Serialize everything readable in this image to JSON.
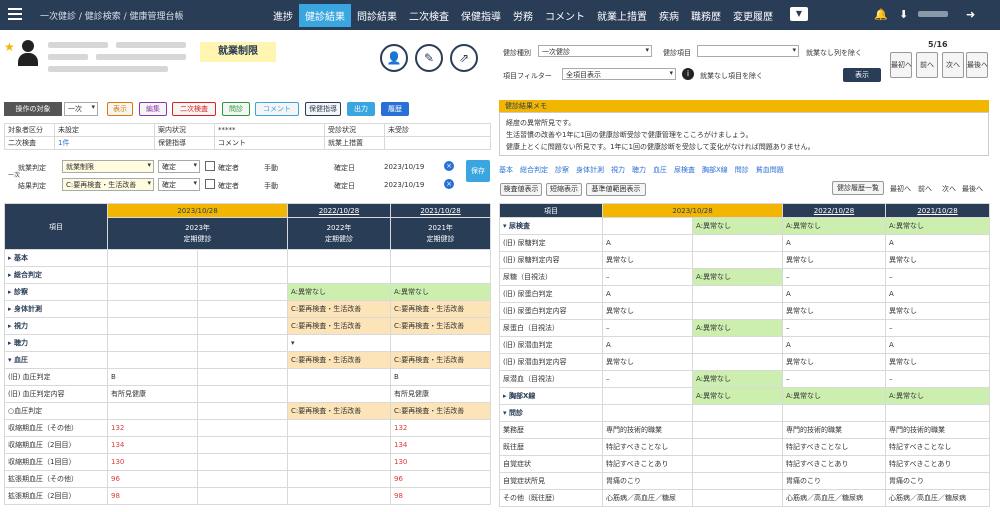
{
  "topbar": {
    "breadcrumb": "一次健診 / 健診検索 / 健康管理台帳",
    "nav": [
      "進捗",
      "健診結果",
      "問診結果",
      "二次検査",
      "保健指導",
      "労務",
      "コメント",
      "就業上措置",
      "疾病",
      "職務歴",
      "変更履歴"
    ],
    "active": "健診結果",
    "nav_toggle": "▼",
    "bell": "🔔",
    "download": "⬇",
    "logout": "➜"
  },
  "patient": {
    "star": "★",
    "status_badge": "就業制限"
  },
  "icon_buttons": {
    "person": "👤",
    "edit": "✎",
    "open": "⇗"
  },
  "filters": {
    "type_label": "健診種別",
    "type_value": "一次健診",
    "category_label": "健診項目",
    "work_label": "就業なし列を除く",
    "item_filter_label": "項目フィルター",
    "item_filter_value": "全項目表示",
    "noitem_label": "就業なし項目を除く",
    "show_btn": "表示",
    "info": "i"
  },
  "paging": {
    "count": "5/16",
    "buttons": [
      "最初へ",
      "前へ",
      "次へ",
      "最後へ"
    ]
  },
  "toolbar": {
    "target": "操作の対象",
    "target_value": "一次",
    "buttons": [
      "表示",
      "編集",
      "二次検査",
      "問診",
      "コメント",
      "保健指導",
      "出力",
      "履歴"
    ]
  },
  "info_table": {
    "rows": [
      [
        "対象者区分",
        "未設定",
        "案内状況",
        "*****",
        "受診状況",
        "未受診"
      ],
      [
        "二次検査",
        "1件",
        "保健指導",
        "コメント",
        "就業上措置",
        ""
      ]
    ]
  },
  "judgement": {
    "rows": [
      {
        "label": "就業判定",
        "value": "就業制限",
        "status": "確定",
        "checkbox": "確定者",
        "hand": "手動",
        "date_label": "確定日",
        "date": "2023/10/19"
      },
      {
        "label": "結果判定",
        "value": "C:要再検査・生活改善",
        "status": "確定",
        "checkbox": "確定者",
        "hand": "手動",
        "date_label": "確定日",
        "date": "2023/10/19"
      }
    ],
    "save": "保存",
    "side": "一次"
  },
  "memo": {
    "title": "健診結果メモ",
    "lines": [
      "経度の異常所見です。",
      "生活習慣の改善や1年に1回の健康診断受診で健康管理をこころがけましょう。",
      "健康上とくに問題ない所見です。1年に1回の健康診断を受診して変化がなければ問題ありません。"
    ]
  },
  "item_links": [
    "基本",
    "総合判定",
    "診察",
    "身体計測",
    "視力",
    "聴力",
    "血圧",
    "尿検査",
    "胸部X線",
    "問診",
    "貧血問題"
  ],
  "right_buttons": {
    "left": [
      "検査値表示",
      "短縮表示",
      "基準値範囲表示"
    ],
    "history": "健診履歴一覧",
    "nav": [
      "最初へ",
      "前へ",
      "次へ",
      "最後へ"
    ]
  },
  "left_table": {
    "header": {
      "item": "項目",
      "date1": "2023/10/28",
      "title1a": "2023年",
      "title1b": "定期健診",
      "date2": "2022/10/28",
      "title2a": "2022年",
      "title2b": "定期健診",
      "date3": "2021/10/28",
      "title3a": "2021年",
      "title3b": "定期健診"
    },
    "rows": [
      [
        "▸ 基本",
        "",
        "",
        "",
        "",
        ""
      ],
      [
        "▸ 総合判定",
        "",
        "",
        "",
        "",
        ""
      ],
      [
        "▸ 診察",
        "",
        "",
        "A:異常なし",
        "A:異常なし",
        "A:異常なし"
      ],
      [
        "▸ 身体計測",
        "",
        "",
        "C:要再検査・生活改善",
        "C:要再検査・生活改善",
        "C:要再検査・生活改善"
      ],
      [
        "▸ 視力",
        "",
        "",
        "C:要再検査・生活改善",
        "C:要再検査・生活改善",
        "C:要再検査・生活改善"
      ],
      [
        "▸ 聴力",
        "",
        "",
        "▾",
        "",
        ""
      ],
      [
        "▾ 血圧",
        "",
        "",
        "C:要再検査・生活改善",
        "C:要再検査・生活改善",
        "C:要再検査・生活改善"
      ],
      [
        "(旧) 血圧判定",
        "B",
        "",
        "",
        "B",
        "B"
      ],
      [
        "(旧) 血圧判定内容",
        "有所見健康",
        "",
        "",
        "有所見健康",
        "有所見健康"
      ],
      [
        "○血圧判定",
        "",
        "",
        "C:要再検査・生活改善",
        "C:要再検査・生活改善",
        "C:要再検査・生活改善"
      ],
      [
        "収縮期血圧（その他）",
        "132",
        "",
        "",
        "132",
        "132"
      ],
      [
        "収縮期血圧（2回目）",
        "134",
        "",
        "",
        "134",
        "134"
      ],
      [
        "収縮期血圧（1回目）",
        "130",
        "",
        "",
        "130",
        "130"
      ],
      [
        "拡張期血圧（その他）",
        "96",
        "",
        "",
        "96",
        "96"
      ],
      [
        "拡張期血圧（2回目）",
        "98",
        "",
        "",
        "98",
        "98"
      ]
    ]
  },
  "right_table": {
    "header": {
      "item": "項目",
      "date1": "2023/10/28",
      "date2": "2022/10/28",
      "date3": "2021/10/28"
    },
    "rows": [
      [
        "▾ 尿検査",
        "",
        "A:異常なし",
        "A:異常なし",
        "A:異常なし"
      ],
      [
        "(旧) 尿糖判定",
        "A",
        "",
        "A",
        "A"
      ],
      [
        "(旧) 尿糖判定内容",
        "異常なし",
        "",
        "異常なし",
        "異常なし"
      ],
      [
        "尿糖（目視法）",
        "–",
        "A:異常なし",
        "–",
        "–"
      ],
      [
        "(旧) 尿蛋白判定",
        "A",
        "",
        "A",
        "A"
      ],
      [
        "(旧) 尿蛋白判定内容",
        "異常なし",
        "",
        "異常なし",
        "異常なし"
      ],
      [
        "尿蛋白（目視法）",
        "–",
        "A:異常なし",
        "–",
        "–"
      ],
      [
        "(旧) 尿潜血判定",
        "A",
        "",
        "A",
        "A"
      ],
      [
        "(旧) 尿潜血判定内容",
        "異常なし",
        "",
        "異常なし",
        "異常なし"
      ],
      [
        "尿潜血（目視法）",
        "–",
        "A:異常なし",
        "–",
        "–"
      ],
      [
        "▸ 胸部X線",
        "",
        "A:異常なし",
        "A:異常なし",
        "A:異常なし"
      ],
      [
        "▾ 問診",
        "",
        "",
        "",
        ""
      ],
      [
        "業務歴",
        "専門的技術的職業",
        "",
        "専門的技術的職業",
        "専門的技術的職業"
      ],
      [
        "既往歴",
        "特記すべきことなし",
        "",
        "特記すべきことなし",
        "特記すべきことなし"
      ],
      [
        "自覚症状",
        "特記すべきことあり",
        "",
        "特記すべきことあり",
        "特記すべきことあり"
      ],
      [
        "自覚症状所見",
        "胃痛のこり",
        "",
        "胃痛のこり",
        "胃痛のこり"
      ],
      [
        "その他（既往歴）",
        "心筋病／高血圧／糖尿",
        "",
        "心筋病／高血圧／糖尿病",
        "心筋病／高血圧／糖尿病"
      ]
    ]
  }
}
